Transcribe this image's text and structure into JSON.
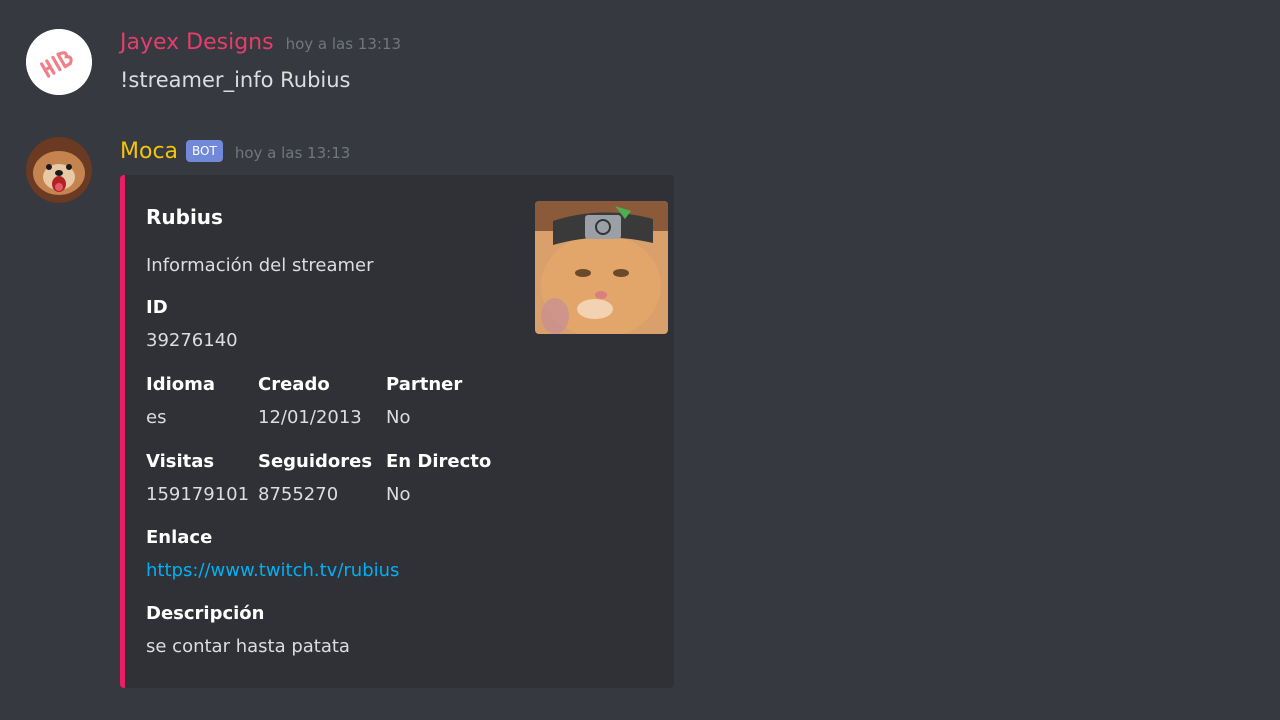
{
  "messages": [
    {
      "username": "Jayex Designs",
      "username_color": "#e63e6a",
      "timestamp": "hoy a las 13:13",
      "content": "!streamer_info Rubius",
      "avatar_icon": "jayex-logo-icon"
    },
    {
      "username": "Moca",
      "username_color": "#f1c40f",
      "bot_tag": "BOT",
      "timestamp": "hoy a las 13:13",
      "avatar_icon": "dog-avatar-icon"
    }
  ],
  "embed": {
    "accent_color": "#e91e63",
    "title": "Rubius",
    "description": "Información del streamer",
    "thumbnail_icon": "cat-with-headband-image",
    "fields": {
      "id": {
        "name": "ID",
        "value": "39276140"
      },
      "idioma": {
        "name": "Idioma",
        "value": "es"
      },
      "creado": {
        "name": "Creado",
        "value": "12/01/2013"
      },
      "partner": {
        "name": "Partner",
        "value": "No"
      },
      "visitas": {
        "name": "Visitas",
        "value": "159179101"
      },
      "seguidores": {
        "name": "Seguidores",
        "value": "8755270"
      },
      "en_directo": {
        "name": "En Directo",
        "value": "No"
      },
      "enlace": {
        "name": "Enlace",
        "value": "https://www.twitch.tv/rubius"
      },
      "descripcion": {
        "name": "Descripción",
        "value": "se contar hasta patata"
      }
    }
  }
}
